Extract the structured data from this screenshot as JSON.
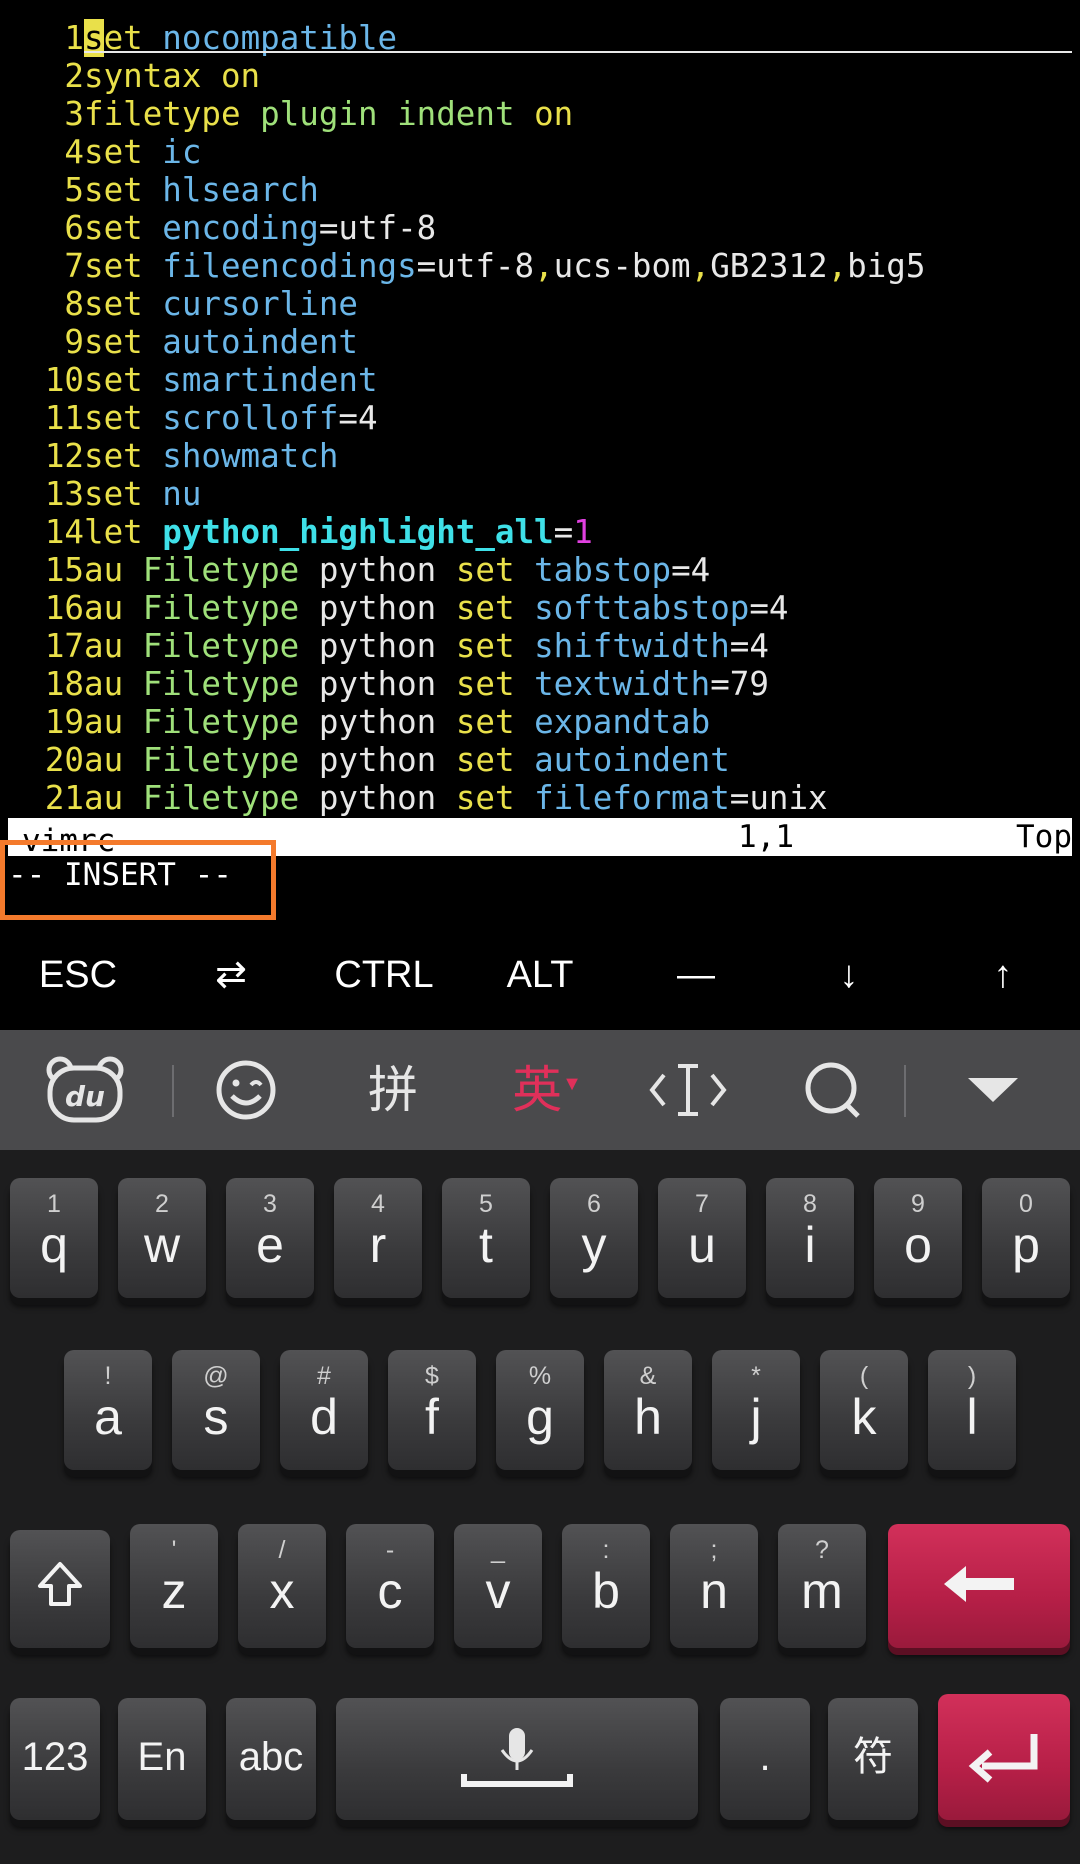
{
  "editor": {
    "lines": [
      {
        "n": "1",
        "segs": [
          [
            "set",
            "#e9e04a"
          ],
          [
            " ",
            "#e8e8e8"
          ],
          [
            "nocompatible",
            "#6bb6e8"
          ]
        ]
      },
      {
        "n": "2",
        "segs": [
          [
            "syntax",
            "#e9e04a"
          ],
          [
            " ",
            "#e8e8e8"
          ],
          [
            "on",
            "#e9e04a"
          ]
        ]
      },
      {
        "n": "3",
        "segs": [
          [
            "filetype",
            "#e9e04a"
          ],
          [
            " ",
            "#e8e8e8"
          ],
          [
            "plugin",
            "#9fe07a"
          ],
          [
            " ",
            "#e8e8e8"
          ],
          [
            "indent",
            "#9fe07a"
          ],
          [
            " ",
            "#e8e8e8"
          ],
          [
            "on",
            "#e9e04a"
          ]
        ]
      },
      {
        "n": "4",
        "segs": [
          [
            "set",
            "#e9e04a"
          ],
          [
            " ",
            "#e8e8e8"
          ],
          [
            "ic",
            "#6bb6e8"
          ]
        ]
      },
      {
        "n": "5",
        "segs": [
          [
            "set",
            "#e9e04a"
          ],
          [
            " ",
            "#e8e8e8"
          ],
          [
            "hlsearch",
            "#6bb6e8"
          ]
        ]
      },
      {
        "n": "6",
        "segs": [
          [
            "set",
            "#e9e04a"
          ],
          [
            " ",
            "#e8e8e8"
          ],
          [
            "encoding",
            "#6bb6e8"
          ],
          [
            "=utf-8",
            "#e8e8e8"
          ]
        ]
      },
      {
        "n": "7",
        "segs": [
          [
            "set",
            "#e9e04a"
          ],
          [
            " ",
            "#e8e8e8"
          ],
          [
            "fileencodings",
            "#6bb6e8"
          ],
          [
            "=utf-8",
            "#e8e8e8"
          ],
          [
            ",",
            "#e9e04a"
          ],
          [
            "ucs-bom",
            "#e8e8e8"
          ],
          [
            ",",
            "#e9e04a"
          ],
          [
            "GB2312",
            "#e8e8e8"
          ],
          [
            ",",
            "#e9e04a"
          ],
          [
            "big5",
            "#e8e8e8"
          ]
        ]
      },
      {
        "n": "8",
        "segs": [
          [
            "set",
            "#e9e04a"
          ],
          [
            " ",
            "#e8e8e8"
          ],
          [
            "cursorline",
            "#6bb6e8"
          ]
        ]
      },
      {
        "n": "9",
        "segs": [
          [
            "set",
            "#e9e04a"
          ],
          [
            " ",
            "#e8e8e8"
          ],
          [
            "autoindent",
            "#6bb6e8"
          ]
        ]
      },
      {
        "n": "10",
        "segs": [
          [
            "set",
            "#e9e04a"
          ],
          [
            " ",
            "#e8e8e8"
          ],
          [
            "smartindent",
            "#6bb6e8"
          ]
        ]
      },
      {
        "n": "11",
        "segs": [
          [
            "set",
            "#e9e04a"
          ],
          [
            " ",
            "#e8e8e8"
          ],
          [
            "scrolloff",
            "#6bb6e8"
          ],
          [
            "=4",
            "#e8e8e8"
          ]
        ]
      },
      {
        "n": "12",
        "segs": [
          [
            "set",
            "#e9e04a"
          ],
          [
            " ",
            "#e8e8e8"
          ],
          [
            "showmatch",
            "#6bb6e8"
          ]
        ]
      },
      {
        "n": "13",
        "segs": [
          [
            "set",
            "#e9e04a"
          ],
          [
            " ",
            "#e8e8e8"
          ],
          [
            "nu",
            "#6bb6e8"
          ]
        ]
      },
      {
        "n": "14",
        "segs": [
          [
            "let",
            "#e9e04a"
          ],
          [
            " ",
            "#e8e8e8"
          ],
          [
            "python_highlight_all",
            "#3fe0e8",
            "bold"
          ],
          [
            "=",
            "#e8e8e8"
          ],
          [
            "1",
            "#e040e0"
          ]
        ]
      },
      {
        "n": "15",
        "segs": [
          [
            "au",
            "#e9e04a"
          ],
          [
            " ",
            "#e8e8e8"
          ],
          [
            "Filetype",
            "#9fe07a"
          ],
          [
            " python ",
            "#e8e8e8"
          ],
          [
            "set",
            "#e9e04a"
          ],
          [
            " ",
            "#e8e8e8"
          ],
          [
            "tabstop",
            "#6bb6e8"
          ],
          [
            "=4",
            "#e8e8e8"
          ]
        ]
      },
      {
        "n": "16",
        "segs": [
          [
            "au",
            "#e9e04a"
          ],
          [
            " ",
            "#e8e8e8"
          ],
          [
            "Filetype",
            "#9fe07a"
          ],
          [
            " python ",
            "#e8e8e8"
          ],
          [
            "set",
            "#e9e04a"
          ],
          [
            " ",
            "#e8e8e8"
          ],
          [
            "softtabstop",
            "#6bb6e8"
          ],
          [
            "=4",
            "#e8e8e8"
          ]
        ]
      },
      {
        "n": "17",
        "segs": [
          [
            "au",
            "#e9e04a"
          ],
          [
            " ",
            "#e8e8e8"
          ],
          [
            "Filetype",
            "#9fe07a"
          ],
          [
            " python ",
            "#e8e8e8"
          ],
          [
            "set",
            "#e9e04a"
          ],
          [
            " ",
            "#e8e8e8"
          ],
          [
            "shiftwidth",
            "#6bb6e8"
          ],
          [
            "=4",
            "#e8e8e8"
          ]
        ]
      },
      {
        "n": "18",
        "segs": [
          [
            "au",
            "#e9e04a"
          ],
          [
            " ",
            "#e8e8e8"
          ],
          [
            "Filetype",
            "#9fe07a"
          ],
          [
            " python ",
            "#e8e8e8"
          ],
          [
            "set",
            "#e9e04a"
          ],
          [
            " ",
            "#e8e8e8"
          ],
          [
            "textwidth",
            "#6bb6e8"
          ],
          [
            "=79",
            "#e8e8e8"
          ]
        ]
      },
      {
        "n": "19",
        "segs": [
          [
            "au",
            "#e9e04a"
          ],
          [
            " ",
            "#e8e8e8"
          ],
          [
            "Filetype",
            "#9fe07a"
          ],
          [
            " python ",
            "#e8e8e8"
          ],
          [
            "set",
            "#e9e04a"
          ],
          [
            " ",
            "#e8e8e8"
          ],
          [
            "expandtab",
            "#6bb6e8"
          ]
        ]
      },
      {
        "n": "20",
        "segs": [
          [
            "au",
            "#e9e04a"
          ],
          [
            " ",
            "#e8e8e8"
          ],
          [
            "Filetype",
            "#9fe07a"
          ],
          [
            " python ",
            "#e8e8e8"
          ],
          [
            "set",
            "#e9e04a"
          ],
          [
            " ",
            "#e8e8e8"
          ],
          [
            "autoindent",
            "#6bb6e8"
          ]
        ]
      },
      {
        "n": "21",
        "segs": [
          [
            "au",
            "#e9e04a"
          ],
          [
            " ",
            "#e8e8e8"
          ],
          [
            "Filetype",
            "#9fe07a"
          ],
          [
            " python ",
            "#e8e8e8"
          ],
          [
            "set",
            "#e9e04a"
          ],
          [
            " ",
            "#e8e8e8"
          ],
          [
            "fileformat",
            "#6bb6e8"
          ],
          [
            "=unix",
            "#e8e8e8"
          ]
        ]
      }
    ]
  },
  "statusbar": {
    "filename": "vimrc",
    "position": "1,1",
    "scroll": "Top"
  },
  "mode": "-- INSERT --",
  "extra_keys": [
    "ESC",
    "⇄",
    "CTRL",
    "ALT",
    "—",
    "↓",
    "↑"
  ],
  "ime_toolbar": {
    "pinyin": "拼",
    "english": "英"
  },
  "keyboard": {
    "row1": [
      [
        "1",
        "q"
      ],
      [
        "2",
        "w"
      ],
      [
        "3",
        "e"
      ],
      [
        "4",
        "r"
      ],
      [
        "5",
        "t"
      ],
      [
        "6",
        "y"
      ],
      [
        "7",
        "u"
      ],
      [
        "8",
        "i"
      ],
      [
        "9",
        "o"
      ],
      [
        "0",
        "p"
      ]
    ],
    "row2": [
      [
        "!",
        "a"
      ],
      [
        "@",
        "s"
      ],
      [
        "#",
        "d"
      ],
      [
        "$",
        "f"
      ],
      [
        "%",
        "g"
      ],
      [
        "&",
        "h"
      ],
      [
        "*",
        "j"
      ],
      [
        "(",
        "k"
      ],
      [
        ")",
        "l"
      ]
    ],
    "row3": [
      [
        "'",
        "z"
      ],
      [
        "/",
        "x"
      ],
      [
        "-",
        "c"
      ],
      [
        "_",
        "v"
      ],
      [
        ":",
        "b"
      ],
      [
        ";",
        "n"
      ],
      [
        "?",
        "m"
      ]
    ],
    "row4": {
      "num": "123",
      "en": "En",
      "abc": "abc",
      "period": ".",
      "symbol": "符"
    }
  },
  "colors": {
    "accent_red": "#c4234d",
    "highlight_orange": "#f47a2c"
  }
}
